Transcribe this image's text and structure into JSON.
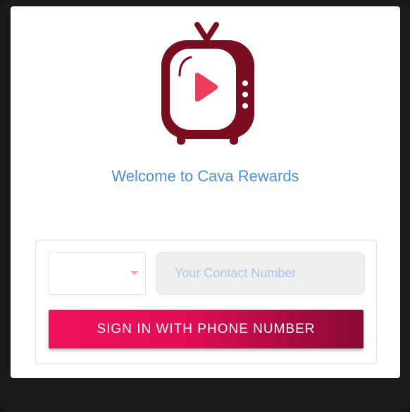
{
  "welcome_text": "Welcome to Cava Rewards",
  "logo": {
    "icon": "tv-play-icon",
    "primary_color": "#7a0d1f",
    "play_color": "#f23a5d"
  },
  "login": {
    "country_code_value": "",
    "phone_placeholder": "Your Contact Number",
    "phone_value": "",
    "signin_label": "SIGN IN WITH PHONE NUMBER"
  },
  "colors": {
    "welcome_text": "#4a8fd0",
    "button_gradient_start": "#f0115c",
    "button_gradient_end": "#8a0a32"
  }
}
